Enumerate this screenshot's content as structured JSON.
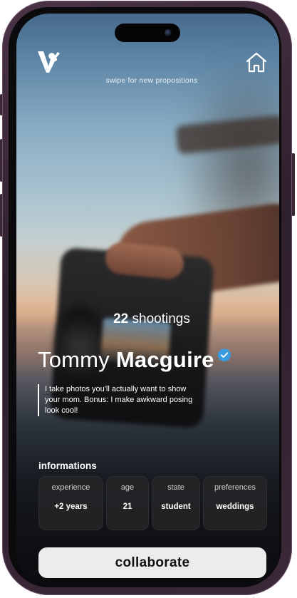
{
  "header": {
    "logo_icon": "v-brand-logo-icon",
    "home_icon": "home-icon",
    "swipe_hint": "swipe for new propositions"
  },
  "profile": {
    "shootings_count": "22",
    "shootings_label": "shootings",
    "first_name": "Tommy",
    "last_name": "Macguire",
    "verified_icon": "verified-badge-icon",
    "verified_color": "#3b9be0",
    "bio": "I take photos you'll actually want to show your mom. Bonus: I make awkward posing look cool!"
  },
  "informations": {
    "title": "informations",
    "cards": [
      {
        "label": "experience",
        "value": "+2 years"
      },
      {
        "label": "age",
        "value": "21"
      },
      {
        "label": "state",
        "value": "student"
      },
      {
        "label": "preferences",
        "value": "weddings"
      }
    ]
  },
  "cta": {
    "label": "collaborate",
    "background": "#ececec"
  }
}
